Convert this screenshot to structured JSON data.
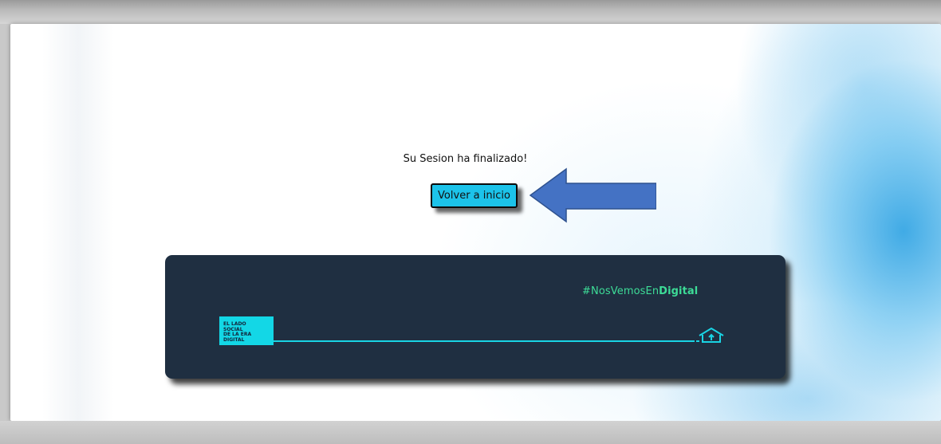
{
  "page": {
    "message": "Su Sesion ha finalizado!",
    "home_button_label": "Volver a inicio"
  },
  "banner": {
    "hashtag_prefix": "#NosVemosEn",
    "hashtag_emphasis": "Digital",
    "logo_lines": [
      "EL LADO",
      "SOCIAL",
      "DE LA ERA",
      "DIGITAL"
    ],
    "house_icon": "home-icon"
  },
  "annotation": {
    "arrow_icon": "left-arrow-annotation",
    "arrow_color": "#4472c4"
  },
  "colors": {
    "button_bg": "#1cc3ea",
    "banner_bg": "#1f2f41",
    "accent_green": "#3ddc97",
    "accent_cyan": "#13d7e6"
  }
}
